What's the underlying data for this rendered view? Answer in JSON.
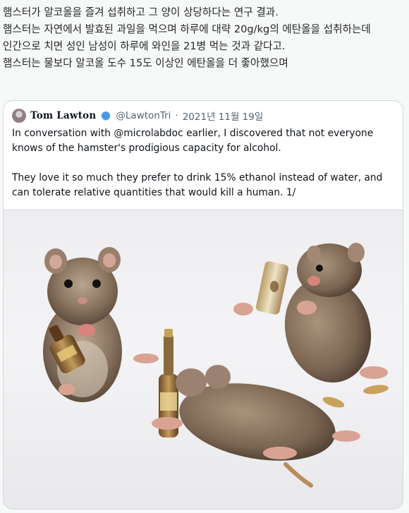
{
  "post": {
    "text": "햄스터가 알코올을 즐겨 섭취하고 그 양이 상당하다는 연구 결과.\n햄스터는 자연에서 발효된 과일을 먹으며 하루에 대략 20g/kg의 에탄올을 섭취하는데 인간으로 치면 성인 남성이 하루에 와인을 21병 먹는 것과 같다고.\n햄스터는 물보다 알코올 도수 15도 이상인 에탄올을 더 좋아했으며"
  },
  "quoted_tweet": {
    "display_name": "Tom Lawton",
    "handle": "@LawtonTri",
    "separator": "·",
    "date": "2021년 11월 19일",
    "paragraphs": [
      "In conversation with @microlabdoc earlier, I discovered that not everyone knows of the hamster's prodigious capacity for alcohol.",
      "They love it so much they prefer to drink 15% ethanol instead of water, and can tolerate relative quantities that would kill a human. 1/"
    ],
    "media_icon": "photo-hamsters-with-bottles"
  },
  "colors": {
    "verified": "#4a99e9",
    "secondary_text": "#536471",
    "border": "#cfd9de"
  }
}
